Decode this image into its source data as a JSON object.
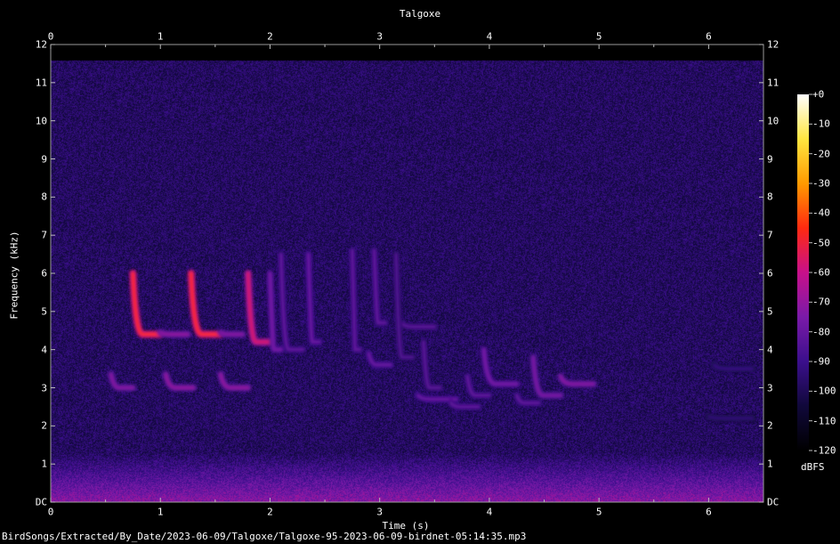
{
  "chart_data": {
    "type": "heatmap",
    "title": "Talgoxe",
    "xlabel": "Time (s)",
    "ylabel": "Frequency (kHz)",
    "xlim": [
      0,
      6.5
    ],
    "ylim": [
      0,
      12
    ],
    "x_ticks": [
      {
        "value": 0,
        "label": "0"
      },
      {
        "value": 1,
        "label": "1"
      },
      {
        "value": 2,
        "label": "2"
      },
      {
        "value": 3,
        "label": "3"
      },
      {
        "value": 4,
        "label": "4"
      },
      {
        "value": 5,
        "label": "5"
      },
      {
        "value": 6,
        "label": "6"
      }
    ],
    "y_ticks": [
      {
        "value": 0,
        "label": "DC"
      },
      {
        "value": 1,
        "label": "1"
      },
      {
        "value": 2,
        "label": "2"
      },
      {
        "value": 3,
        "label": "3"
      },
      {
        "value": 4,
        "label": "4"
      },
      {
        "value": 5,
        "label": "5"
      },
      {
        "value": 6,
        "label": "6"
      },
      {
        "value": 7,
        "label": "7"
      },
      {
        "value": 8,
        "label": "8"
      },
      {
        "value": 9,
        "label": "9"
      },
      {
        "value": 10,
        "label": "10"
      },
      {
        "value": 11,
        "label": "11"
      },
      {
        "value": 12,
        "label": "12"
      }
    ],
    "colorbar": {
      "unit": "dBFS",
      "range": [
        -120,
        0
      ],
      "ticks": [
        {
          "value": 0,
          "label": "+0"
        },
        {
          "value": -10,
          "label": "-10"
        },
        {
          "value": -20,
          "label": "-20"
        },
        {
          "value": -30,
          "label": "-30"
        },
        {
          "value": -40,
          "label": "-40"
        },
        {
          "value": -50,
          "label": "-50"
        },
        {
          "value": -60,
          "label": "-60"
        },
        {
          "value": -70,
          "label": "-70"
        },
        {
          "value": -80,
          "label": "-80"
        },
        {
          "value": -90,
          "label": "-90"
        },
        {
          "value": -100,
          "label": "-100"
        },
        {
          "value": -110,
          "label": "-110"
        },
        {
          "value": -120,
          "label": "-120"
        }
      ],
      "colors": [
        "#000000",
        "#10083a",
        "#3b0f8c",
        "#7a1aa8",
        "#c8108a",
        "#ff2a10",
        "#ff9a00",
        "#ffe640",
        "#ffffff"
      ]
    },
    "noise_floor_dbfs": -98,
    "signal_top_khz": 11.6,
    "calls": [
      {
        "t0": 0.55,
        "t1": 0.75,
        "f_start": 3.35,
        "f_end": 3.0,
        "level": -72
      },
      {
        "t0": 0.75,
        "t1": 1.0,
        "f_start": 6.0,
        "f_end": 4.4,
        "level": -45
      },
      {
        "t0": 1.0,
        "t1": 1.25,
        "f_start": 4.45,
        "f_end": 4.4,
        "level": -70
      },
      {
        "t0": 1.05,
        "t1": 1.3,
        "f_start": 3.35,
        "f_end": 3.0,
        "level": -70
      },
      {
        "t0": 1.28,
        "t1": 1.55,
        "f_start": 6.0,
        "f_end": 4.4,
        "level": -45
      },
      {
        "t0": 1.55,
        "t1": 1.75,
        "f_start": 4.45,
        "f_end": 4.4,
        "level": -72
      },
      {
        "t0": 1.55,
        "t1": 1.8,
        "f_start": 3.35,
        "f_end": 3.0,
        "level": -70
      },
      {
        "t0": 1.8,
        "t1": 2.0,
        "f_start": 6.0,
        "f_end": 4.2,
        "level": -55
      },
      {
        "t0": 2.0,
        "t1": 2.1,
        "f_start": 6.0,
        "f_end": 4.0,
        "level": -75
      },
      {
        "t0": 2.1,
        "t1": 2.3,
        "f_start": 6.5,
        "f_end": 4.0,
        "level": -80
      },
      {
        "t0": 2.35,
        "t1": 2.45,
        "f_start": 6.5,
        "f_end": 4.2,
        "level": -78
      },
      {
        "t0": 2.75,
        "t1": 2.82,
        "f_start": 6.6,
        "f_end": 4.0,
        "level": -80
      },
      {
        "t0": 2.9,
        "t1": 3.1,
        "f_start": 3.9,
        "f_end": 3.6,
        "level": -78
      },
      {
        "t0": 2.95,
        "t1": 3.05,
        "f_start": 6.6,
        "f_end": 4.7,
        "level": -80
      },
      {
        "t0": 3.2,
        "t1": 3.5,
        "f_start": 4.7,
        "f_end": 4.6,
        "level": -82
      },
      {
        "t0": 3.15,
        "t1": 3.3,
        "f_start": 6.5,
        "f_end": 3.8,
        "level": -84
      },
      {
        "t0": 3.35,
        "t1": 3.7,
        "f_start": 2.8,
        "f_end": 2.7,
        "level": -78
      },
      {
        "t0": 3.4,
        "t1": 3.55,
        "f_start": 4.2,
        "f_end": 3.0,
        "level": -82
      },
      {
        "t0": 3.65,
        "t1": 3.9,
        "f_start": 2.6,
        "f_end": 2.5,
        "level": -80
      },
      {
        "t0": 3.8,
        "t1": 4.0,
        "f_start": 3.3,
        "f_end": 2.8,
        "level": -80
      },
      {
        "t0": 3.95,
        "t1": 4.25,
        "f_start": 4.0,
        "f_end": 3.1,
        "level": -75
      },
      {
        "t0": 4.25,
        "t1": 4.45,
        "f_start": 2.8,
        "f_end": 2.6,
        "level": -80
      },
      {
        "t0": 4.4,
        "t1": 4.65,
        "f_start": 3.8,
        "f_end": 2.8,
        "level": -74
      },
      {
        "t0": 4.65,
        "t1": 4.95,
        "f_start": 3.3,
        "f_end": 3.1,
        "level": -72
      },
      {
        "t0": 6.05,
        "t1": 6.4,
        "f_start": 3.6,
        "f_end": 3.5,
        "level": -90
      },
      {
        "t0": 6.0,
        "t1": 6.4,
        "f_start": 2.25,
        "f_end": 2.2,
        "level": -92
      }
    ]
  },
  "filename": "BirdSongs/Extracted/By_Date/2023-06-09/Talgoxe/Talgoxe-95-2023-06-09-birdnet-05:14:35.mp3"
}
